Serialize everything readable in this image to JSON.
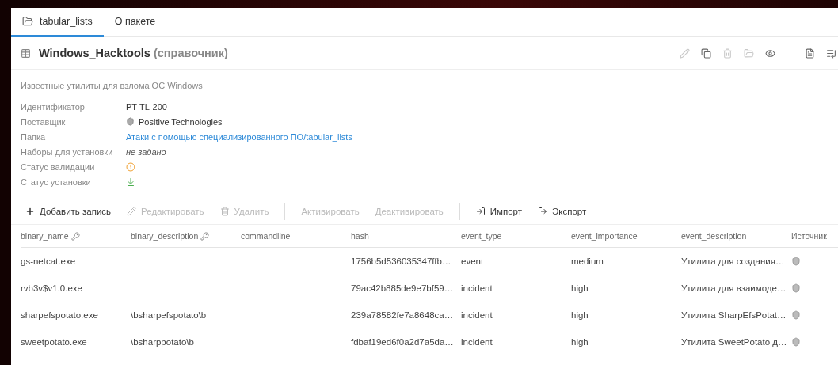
{
  "tabs": [
    {
      "label": "tabular_lists",
      "kind": "folder",
      "selected": true
    },
    {
      "label": "О пакете",
      "kind": "plain",
      "selected": false
    }
  ],
  "header": {
    "title": "Windows_Hacktools",
    "subtitle": "(справочник)",
    "actions": [
      {
        "kind": "edit",
        "disabled": true
      },
      {
        "kind": "copy",
        "disabled": false
      },
      {
        "kind": "delete",
        "disabled": true
      },
      {
        "kind": "folder",
        "disabled": true
      },
      {
        "kind": "view",
        "disabled": false
      },
      {
        "kind": "separator"
      },
      {
        "kind": "document",
        "disabled": false
      },
      {
        "kind": "list",
        "disabled": false
      }
    ]
  },
  "description": "Известные утилиты для взлома ОС Windows",
  "properties": [
    {
      "label": "Идентификатор",
      "kind": "text",
      "value": "PT-TL-200"
    },
    {
      "label": "Поставщик",
      "kind": "vendor",
      "value": "Positive Technologies"
    },
    {
      "label": "Папка",
      "kind": "link",
      "value": "Атаки с помощью специализированного ПО/tabular_lists"
    },
    {
      "label": "Наборы для установки",
      "kind": "empty",
      "value": "не задано"
    },
    {
      "label": "Статус валидации",
      "kind": "warning"
    },
    {
      "label": "Статус установки",
      "kind": "installed"
    }
  ],
  "toolbar": [
    {
      "label": "Добавить запись",
      "kind": "add",
      "disabled": false
    },
    {
      "label": "Редактировать",
      "kind": "edit",
      "disabled": true
    },
    {
      "label": "Удалить",
      "kind": "delete",
      "disabled": true
    },
    {
      "kind": "separator"
    },
    {
      "label": "Активировать",
      "kind": "plain",
      "disabled": true
    },
    {
      "label": "Деактивировать",
      "kind": "plain",
      "disabled": true
    },
    {
      "kind": "separator"
    },
    {
      "label": "Импорт",
      "kind": "import",
      "disabled": false
    },
    {
      "label": "Экспорт",
      "kind": "export",
      "disabled": false
    }
  ],
  "table": {
    "columns": [
      {
        "label": "binary_name",
        "key": true
      },
      {
        "label": "binary_description",
        "key": true
      },
      {
        "label": "commandline",
        "key": false
      },
      {
        "label": "hash",
        "key": false
      },
      {
        "label": "event_type",
        "key": false
      },
      {
        "label": "event_importance",
        "key": false
      },
      {
        "label": "event_description",
        "key": false
      },
      {
        "label": "Источник",
        "key": false
      }
    ],
    "rows": [
      {
        "cells": [
          "gs-netcat.exe",
          "",
          "",
          "1756b5d536035347ffb…",
          "event",
          "medium",
          "Утилита для создания…"
        ]
      },
      {
        "cells": [
          "rvb3v$v1.0.exe",
          "",
          "",
          "79ac42b885de9e7bf59…",
          "incident",
          "high",
          "Утилита для взаимоде…"
        ]
      },
      {
        "cells": [
          "sharpefspotato.exe",
          "\\bsharpefspotato\\b",
          "",
          "239a78582fe7a8648ca…",
          "incident",
          "high",
          "Утилита SharpEfsPotat…"
        ]
      },
      {
        "cells": [
          "sweetpotato.exe",
          "\\bsharppotato\\b",
          "",
          "fdbaf19ed6f0a2d7a5da…",
          "incident",
          "high",
          "Утилита SweetPotato д…"
        ]
      }
    ]
  }
}
